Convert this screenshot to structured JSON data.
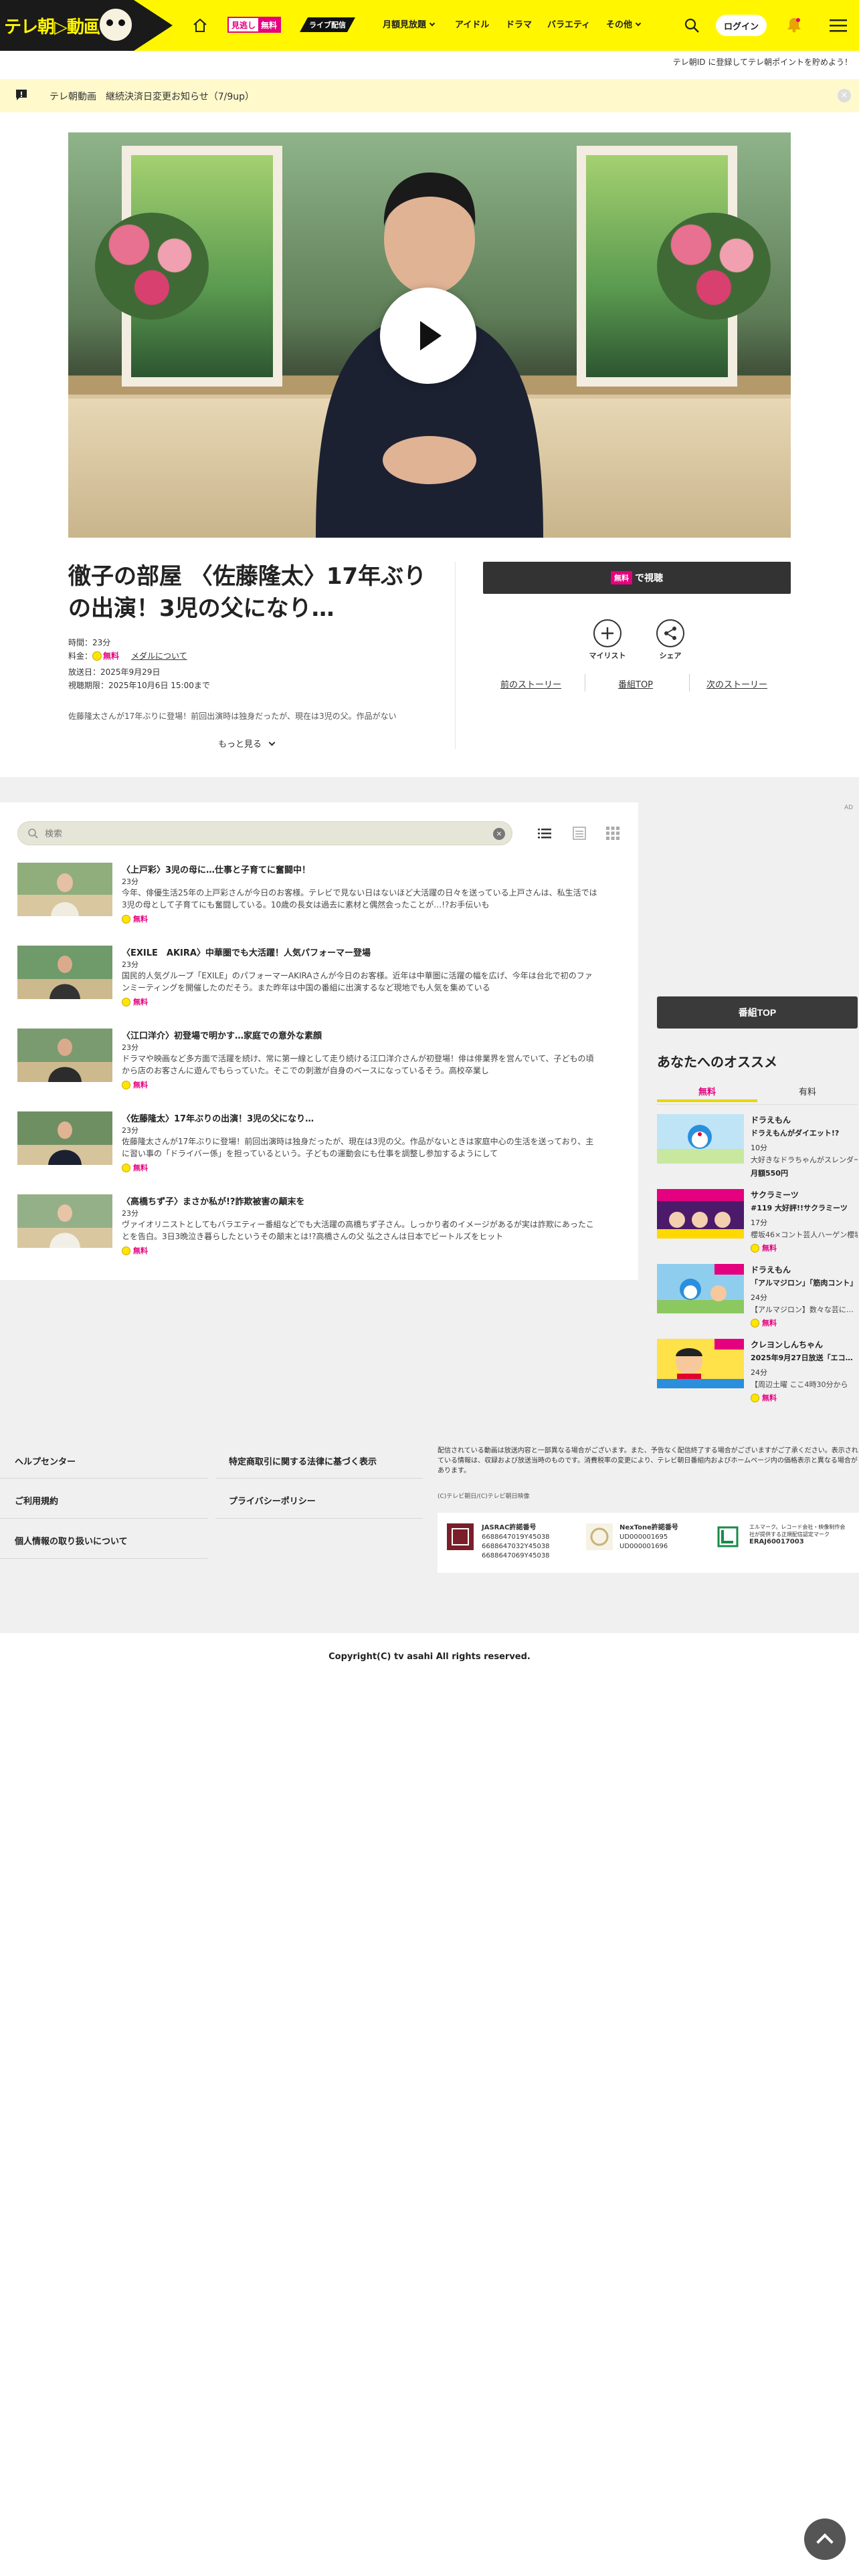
{
  "header": {
    "logo_text": "テレ朝▷動画",
    "mitogashi_a": "見逃し",
    "mitogashi_b": "無料",
    "live_label": "ライブ配信",
    "nav": [
      {
        "label": "月額見放題",
        "has_menu": true
      },
      {
        "label": "アイドル",
        "has_menu": false
      },
      {
        "label": "ドラマ",
        "has_menu": false
      },
      {
        "label": "バラエティ",
        "has_menu": false
      },
      {
        "label": "その他",
        "has_menu": true
      }
    ],
    "login_label": "ログイン",
    "accent_color": "#fff600"
  },
  "subbar": {
    "text": "テレ朝ID に登録してテレ朝ポイントを貯めよう！"
  },
  "notice": {
    "text": "テレ朝動画　継続決済日変更お知らせ（7/9up）",
    "close": "×"
  },
  "program": {
    "title": "徹子の部屋 〈佐藤隆太〉17年ぶりの出演！3児の父になり…",
    "duration": "時間：23分",
    "price_label": "料金：",
    "price_free": "無料",
    "medal_link": "メダルについて",
    "aired": "放送日：2025年9月29日",
    "deadline": "視聴期限：2025年10月6日 15:00まで",
    "description": "佐藤隆太さんが17年ぶりに登場！前回出演時は独身だったが、現在は3児の父。作品がない",
    "more_label": "もっと見る",
    "watch_free_tag": "無料",
    "watch_label": "で視聴",
    "mylist_label": "マイリスト",
    "share_label": "シェア",
    "prev_story": "前のストーリー",
    "program_top": "番組TOP",
    "next_story": "次のストーリー"
  },
  "list": {
    "search_placeholder": "検索",
    "episodes": [
      {
        "title": "〈上戸彩〉3児の母に…仕事と子育てに奮闘中！",
        "length": "23分",
        "desc": "今年、俳優生活25年の上戸彩さんが今日のお客様。テレビで見ない日はないほど大活躍の日々を送っている上戸さんは、私生活では3児の母として子育てにも奮闘している。10歳の長女は過去に素材と偶然会ったことが…!?お手伝いも",
        "free": "無料"
      },
      {
        "title": "〈EXILE　AKIRA〉中華圏でも大活躍！人気パフォーマー登場",
        "length": "23分",
        "desc": "国民的人気グループ「EXILE」のパフォーマーAKIRAさんが今日のお客様。近年は中華圏に活躍の幅を広げ、今年は台北で初のファンミーティングを開催したのだそう。また昨年は中国の番組に出演するなど現地でも人気を集めている",
        "free": "無料"
      },
      {
        "title": "〈江口洋介〉初登場で明かす…家庭での意外な素顔",
        "length": "23分",
        "desc": "ドラマや映画など多方面で活躍を続け、常に第一線として走り続ける江口洋介さんが初登場！俳は俳業界を営んでいて、子どもの頃から店のお客さんに遊んでもらっていた。そこでの刺激が自身のベースになっているそう。高校卒業し",
        "free": "無料"
      },
      {
        "title": "〈佐藤隆太〉17年ぶりの出演！3児の父になり…",
        "length": "23分",
        "desc": "佐藤隆太さんが17年ぶりに登場！前回出演時は独身だったが、現在は3児の父。作品がないときは家庭中心の生活を送っており、主に習い事の「ドライバー係」を担っているという。子どもの運動会にも仕事を調整し参加するようにして",
        "free": "無料"
      },
      {
        "title": "〈高橋ちず子〉まさか私が!?詐欺被害の顛末を",
        "length": "23分",
        "desc": "ヴァイオリニストとしてもバラエティー番組などでも大活躍の高橋ちず子さん。しっかり者のイメージがあるが実は詐欺にあったことを告白。3日3晩泣き暮らしたというその顛末とは!?高橋さんの父 弘之さんは日本でビートルズをヒット",
        "free": "無料"
      }
    ]
  },
  "sidebar": {
    "ad_mark": "AD",
    "pagetop_label": "番組TOP",
    "rec_title": "あなたへのオススメ",
    "tab_free": "無料",
    "tab_paid": "有料",
    "recommendations": [
      {
        "name": "ドラえもん",
        "sub": "ドラえもんがダイエット!?",
        "length": "10分",
        "desc": "大好きなドラちゃんがスレンダーに",
        "price": "月額550円",
        "free": ""
      },
      {
        "name": "サクラミーツ",
        "sub": "#119 大好評!!サクラミーツ",
        "length": "17分",
        "desc": "櫻坂46×コント芸人ハーゲン櫻坂",
        "price": "",
        "free": "無料"
      },
      {
        "name": "ドラえもん",
        "sub": "「アルマジロン」「筋肉コント」",
        "length": "24分",
        "desc": "【アルマジロン】数々な芸に…",
        "price": "",
        "free": "無料"
      },
      {
        "name": "クレヨンしんちゃん",
        "sub": "2025年9月27日放送「エコ…",
        "length": "24分",
        "desc": "【周辺土曜 ここ4時30分から",
        "price": "",
        "free": "無料"
      }
    ]
  },
  "footer": {
    "links": [
      "ヘルプセンター",
      "特定商取引に関する法律に基づく表示",
      "ご利用規約",
      "プライバシーポリシー",
      "個人情報の取り扱いについて"
    ],
    "note": "配信されている動画は放送内容と一部異なる場合がございます。また、予告なく配信終了する場合がございますがご了承ください。表示されている情報は、収録および放送当時のものです。消費税率の変更により、テレビ朝日番組内およびホームページ内の価格表示と異なる場合があります。",
    "small": "(C)テレビ朝日/(C)テレビ朝日映像",
    "jasrac_title": "JASRAC許諾番号",
    "jasrac_nums": [
      "6688647019Y45038",
      "6688647032Y45038",
      "6688647069Y45038"
    ],
    "nextone_title": "NexTone許諾番号",
    "nextone_nums": [
      "UD000001695",
      "UD000001696"
    ],
    "riaj_text": "エルマーク。レコード会社・映像制作会社が提供する正規配信認定マーク",
    "riaj_num": "ERAJ60017003",
    "copyright": "Copyright(C) tv asahi All rights reserved."
  }
}
